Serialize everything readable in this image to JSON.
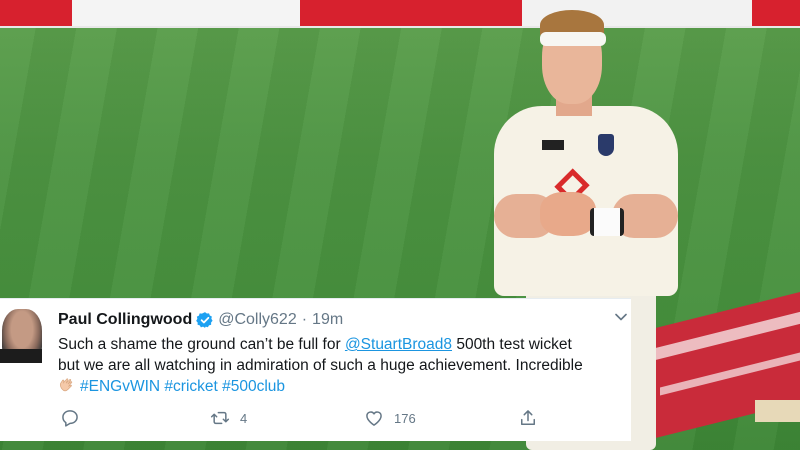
{
  "background": {
    "description_colors": {
      "grass": "#4d9442",
      "pitch_red": "#c92b3a",
      "shirt": "#f6f2e6"
    }
  },
  "tweet": {
    "author": {
      "display_name": "Paul Collingwood",
      "handle": "@Colly622",
      "verified": true,
      "avatar_icon": "avatar-photo"
    },
    "separator": "·",
    "time": "19m",
    "text": {
      "line1_pre": "Such a shame the ground can’t be full for ",
      "mention": "@StuartBroad8",
      "line1_post": " 500th test wicket",
      "line2": "but we are all watching in admiration of such a huge achievement. Incredible",
      "clap_icon": "clapping-hands-emoji",
      "hashtags": [
        "#ENGvWIN",
        "#cricket",
        "#500club"
      ]
    },
    "actions": {
      "reply": {
        "icon": "reply-icon",
        "count": ""
      },
      "retweet": {
        "icon": "retweet-icon",
        "count": "4"
      },
      "like": {
        "icon": "heart-icon",
        "count": "176"
      },
      "share": {
        "icon": "share-icon",
        "count": ""
      }
    },
    "colors": {
      "link": "#1b95e0",
      "text": "#14171a",
      "muted": "#657786",
      "verified": "#1da1f2"
    }
  }
}
